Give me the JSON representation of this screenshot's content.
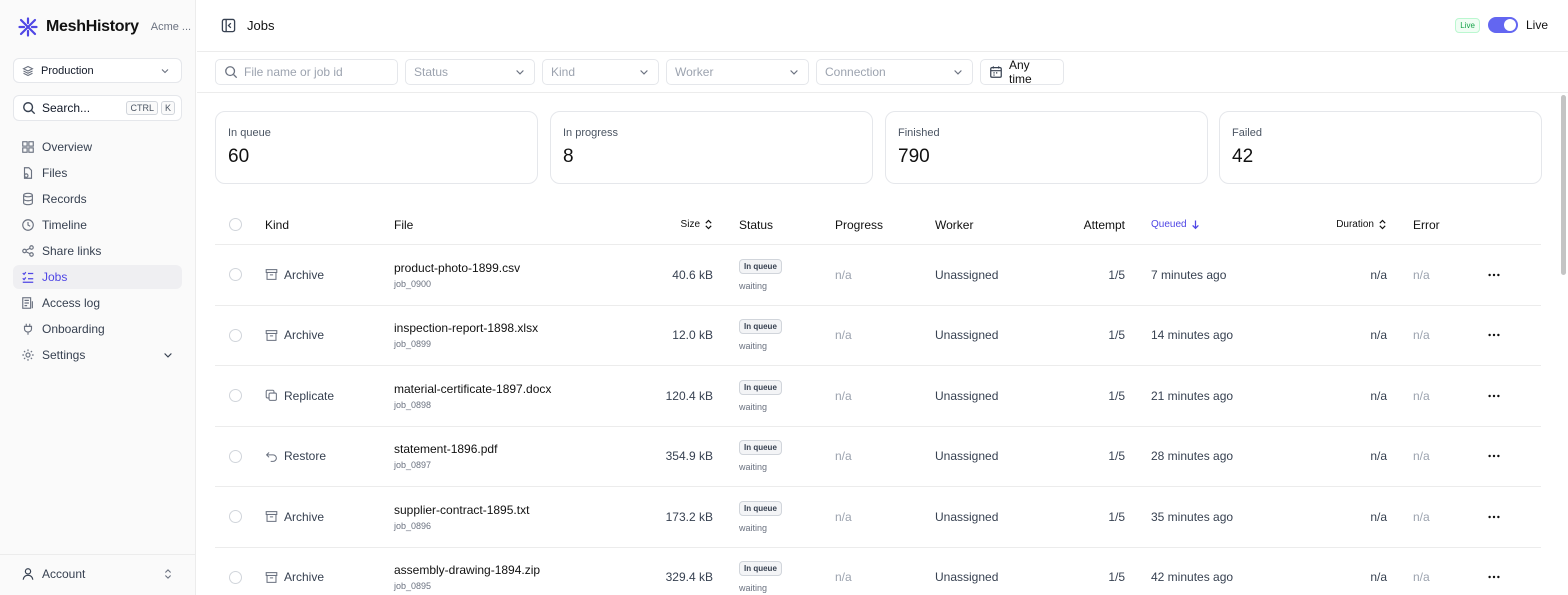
{
  "brand": {
    "name": "MeshHistory",
    "org": "Acme ..."
  },
  "environment": {
    "value": "Production"
  },
  "search": {
    "label": "Search...",
    "kbd1": "CTRL",
    "kbd2": "K"
  },
  "nav": [
    {
      "label": "Overview",
      "icon": "grid-icon"
    },
    {
      "label": "Files",
      "icon": "files-icon"
    },
    {
      "label": "Records",
      "icon": "database-icon"
    },
    {
      "label": "Timeline",
      "icon": "clock-icon"
    },
    {
      "label": "Share links",
      "icon": "share-icon"
    },
    {
      "label": "Jobs",
      "icon": "list-check-icon",
      "active": true
    },
    {
      "label": "Access log",
      "icon": "log-icon"
    },
    {
      "label": "Onboarding",
      "icon": "plug-icon"
    },
    {
      "label": "Settings",
      "icon": "gear-icon"
    }
  ],
  "account": {
    "label": "Account"
  },
  "header": {
    "title": "Jobs",
    "live_badge": "Live",
    "live_label": "Live"
  },
  "filters": {
    "search_placeholder": "File name or job id",
    "status": "Status",
    "kind": "Kind",
    "worker": "Worker",
    "connection": "Connection",
    "time": "Any time"
  },
  "stats": [
    {
      "label": "In queue",
      "value": "60"
    },
    {
      "label": "In progress",
      "value": "8"
    },
    {
      "label": "Finished",
      "value": "790"
    },
    {
      "label": "Failed",
      "value": "42"
    }
  ],
  "columns": {
    "kind": "Kind",
    "file": "File",
    "size": "Size",
    "status": "Status",
    "progress": "Progress",
    "worker": "Worker",
    "attempt": "Attempt",
    "queued": "Queued",
    "duration": "Duration",
    "error": "Error"
  },
  "rows": [
    {
      "kind": "Archive",
      "kind_icon": "archive-icon",
      "file": "product-photo-1899.csv",
      "job_id": "job_0900",
      "size": "40.6 kB",
      "status": "In queue",
      "status_sub": "waiting",
      "progress": "n/a",
      "worker": "Unassigned",
      "attempt": "1/5",
      "queued": "7 minutes ago",
      "duration": "n/a",
      "error": "n/a"
    },
    {
      "kind": "Archive",
      "kind_icon": "archive-icon",
      "file": "inspection-report-1898.xlsx",
      "job_id": "job_0899",
      "size": "12.0 kB",
      "status": "In queue",
      "status_sub": "waiting",
      "progress": "n/a",
      "worker": "Unassigned",
      "attempt": "1/5",
      "queued": "14 minutes ago",
      "duration": "n/a",
      "error": "n/a"
    },
    {
      "kind": "Replicate",
      "kind_icon": "copy-icon",
      "file": "material-certificate-1897.docx",
      "job_id": "job_0898",
      "size": "120.4 kB",
      "status": "In queue",
      "status_sub": "waiting",
      "progress": "n/a",
      "worker": "Unassigned",
      "attempt": "1/5",
      "queued": "21 minutes ago",
      "duration": "n/a",
      "error": "n/a"
    },
    {
      "kind": "Restore",
      "kind_icon": "undo-icon",
      "file": "statement-1896.pdf",
      "job_id": "job_0897",
      "size": "354.9 kB",
      "status": "In queue",
      "status_sub": "waiting",
      "progress": "n/a",
      "worker": "Unassigned",
      "attempt": "1/5",
      "queued": "28 minutes ago",
      "duration": "n/a",
      "error": "n/a"
    },
    {
      "kind": "Archive",
      "kind_icon": "archive-icon",
      "file": "supplier-contract-1895.txt",
      "job_id": "job_0896",
      "size": "173.2 kB",
      "status": "In queue",
      "status_sub": "waiting",
      "progress": "n/a",
      "worker": "Unassigned",
      "attempt": "1/5",
      "queued": "35 minutes ago",
      "duration": "n/a",
      "error": "n/a"
    },
    {
      "kind": "Archive",
      "kind_icon": "archive-icon",
      "file": "assembly-drawing-1894.zip",
      "job_id": "job_0895",
      "size": "329.4 kB",
      "status": "In queue",
      "status_sub": "waiting",
      "progress": "n/a",
      "worker": "Unassigned",
      "attempt": "1/5",
      "queued": "42 minutes ago",
      "duration": "n/a",
      "error": "n/a"
    }
  ],
  "colors": {
    "accent": "#4f46e5",
    "toggle": "#6366f1",
    "live_green": "#16a34a"
  }
}
